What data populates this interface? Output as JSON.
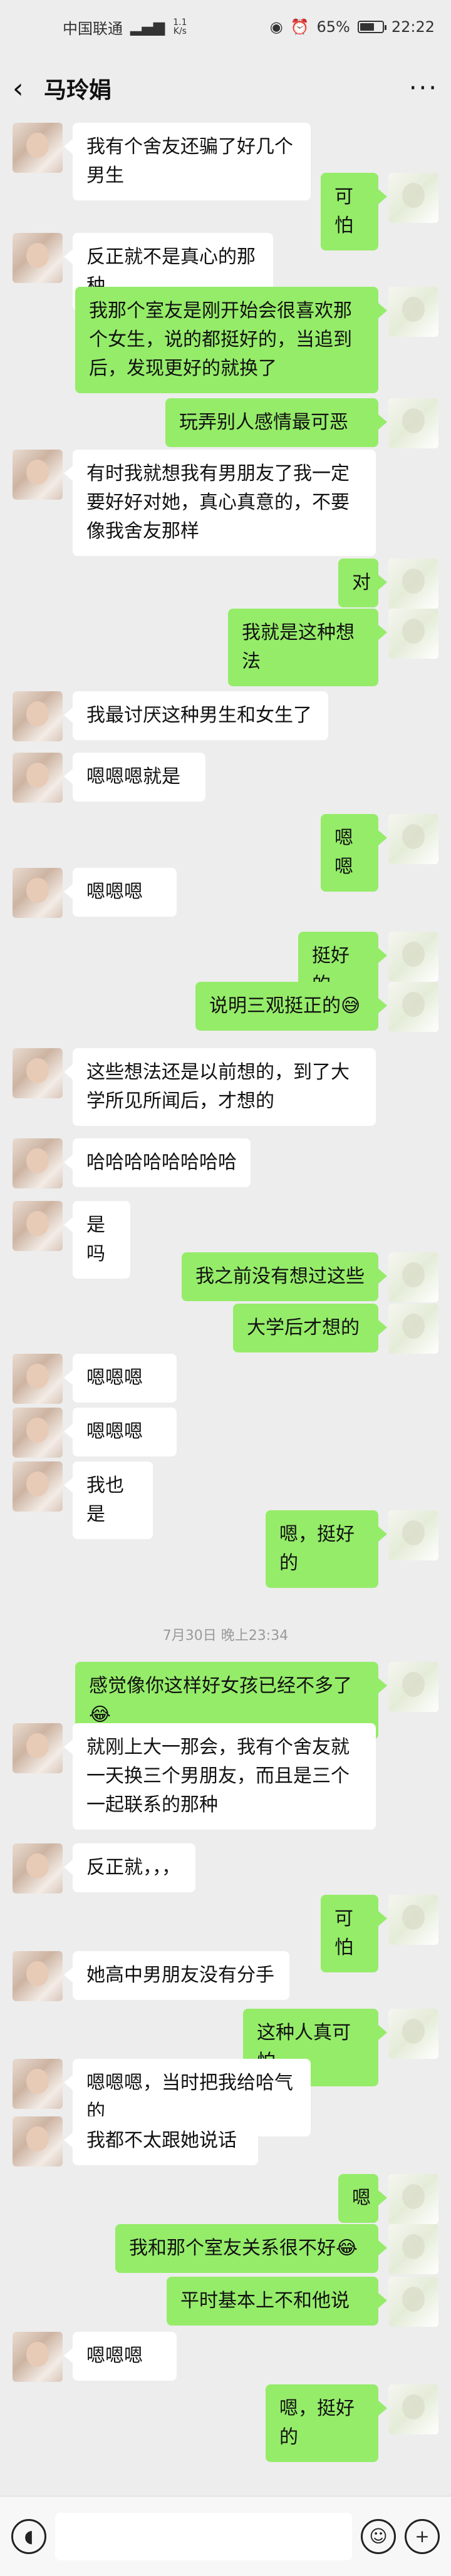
{
  "status_bar": {
    "carrier": "中国联通",
    "net_speed": "1.1 K/s",
    "battery": "65%",
    "battery_level": 0.65,
    "time": "22:22"
  },
  "nav": {
    "title": "马玲娟",
    "back_icon": "back-chevron-icon",
    "more_icon": "more-dots-icon"
  },
  "messages": [
    {
      "from": "in",
      "text": "我有个舍友还骗了好几个男生"
    },
    {
      "from": "out",
      "text": "可怕"
    },
    {
      "from": "in",
      "text": "反正就不是真心的那种"
    },
    {
      "from": "out",
      "text": "我那个室友是刚开始会很喜欢那个女生，说的都挺好的，当追到后，发现更好的就换了"
    },
    {
      "from": "out",
      "text": "玩弄别人感情最可恶"
    },
    {
      "from": "in",
      "text": "有时我就想我有男朋友了我一定要好好对她，真心真意的，不要像我舍友那样"
    },
    {
      "from": "out",
      "text": "对"
    },
    {
      "from": "out",
      "text": "我就是这种想法"
    },
    {
      "from": "in",
      "text": "我最讨厌这种男生和女生了"
    },
    {
      "from": "in",
      "text": "嗯嗯嗯就是"
    },
    {
      "from": "out",
      "text": "嗯嗯"
    },
    {
      "from": "in",
      "text": "嗯嗯嗯"
    },
    {
      "from": "out",
      "text": "挺好的"
    },
    {
      "from": "out",
      "text": "说明三观挺正的😅"
    },
    {
      "from": "in",
      "text": "这些想法还是以前想的，到了大学所见所闻后，才想的"
    },
    {
      "from": "in",
      "text": "哈哈哈哈哈哈哈哈"
    },
    {
      "from": "in",
      "text": "是吗"
    },
    {
      "from": "out",
      "text": "我之前没有想过这些"
    },
    {
      "from": "out",
      "text": "大学后才想的"
    },
    {
      "from": "in",
      "text": "嗯嗯嗯"
    },
    {
      "from": "in",
      "text": "嗯嗯嗯"
    },
    {
      "from": "in",
      "text": "我也是"
    },
    {
      "from": "out",
      "text": "嗯，挺好的"
    },
    {
      "from": "time",
      "text": "7月30日 晚上23:34"
    },
    {
      "from": "out",
      "text": "感觉像你这样好女孩已经不多了😂"
    },
    {
      "from": "in",
      "text": "就刚上大一那会，我有个舍友就一天换三个男朋友，而且是三个一起联系的那种"
    },
    {
      "from": "in",
      "text": "反正就，，，"
    },
    {
      "from": "out",
      "text": "可怕"
    },
    {
      "from": "in",
      "text": "她高中男朋友没有分手"
    },
    {
      "from": "out",
      "text": "这种人真可怕"
    },
    {
      "from": "in",
      "text": "嗯嗯嗯，当时把我给哈气的"
    },
    {
      "from": "in",
      "text": "我都不太跟她说话"
    },
    {
      "from": "out",
      "text": "嗯"
    },
    {
      "from": "out",
      "text": "我和那个室友关系很不好😂"
    },
    {
      "from": "out",
      "text": "平时基本上不和他说"
    },
    {
      "from": "in",
      "text": "嗯嗯嗯"
    },
    {
      "from": "out",
      "text": "嗯，挺好的"
    }
  ],
  "input_bar": {
    "voice_icon": "voice-icon",
    "emoji_icon": "emoji-icon",
    "plus_icon": "plus-icon"
  },
  "colors": {
    "background": "#ededed",
    "incoming_bubble": "#ffffff",
    "outgoing_bubble": "#95ec69"
  }
}
